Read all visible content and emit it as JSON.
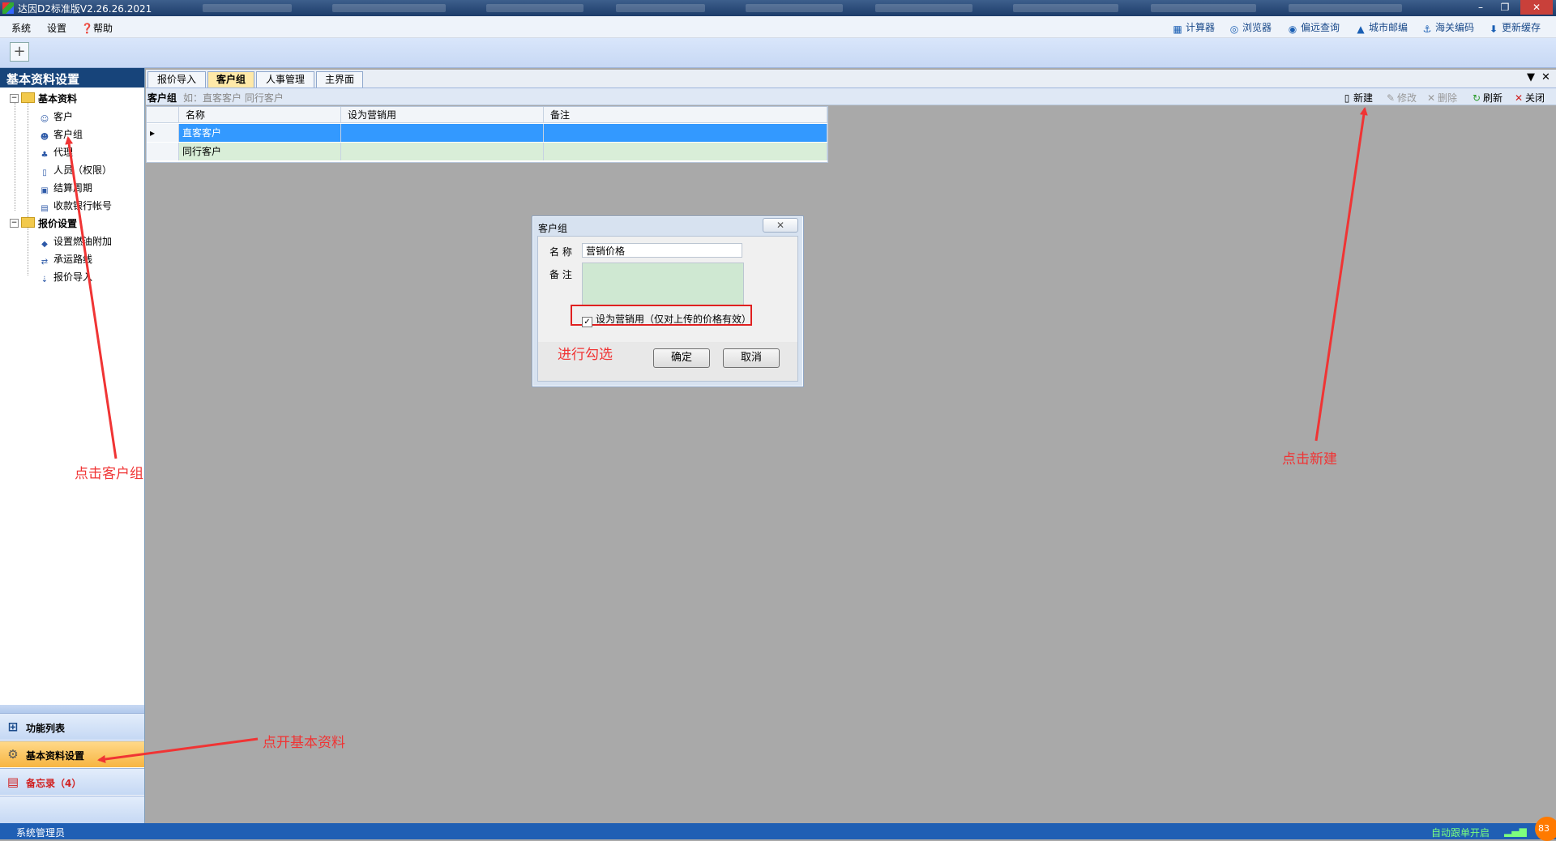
{
  "window": {
    "title": "达因D2标准版V2.26.26.2021",
    "controls": {
      "minimize": "–",
      "restore": "❐",
      "close": "✕"
    }
  },
  "menu": {
    "items": [
      "系统",
      "设置",
      "帮助"
    ]
  },
  "quick_tools": [
    {
      "label": "计算器",
      "icon": "calculator-icon"
    },
    {
      "label": "浏览器",
      "icon": "browser-icon"
    },
    {
      "label": "偏远查询",
      "icon": "location-pin-icon"
    },
    {
      "label": "城市邮编",
      "icon": "city-icon"
    },
    {
      "label": "海关编码",
      "icon": "anchor-icon"
    },
    {
      "label": "更新缓存",
      "icon": "download-icon"
    }
  ],
  "toolbar": {
    "add_symbol": "+"
  },
  "left_panel": {
    "title": "基本资料设置",
    "collapse_glyph": "«",
    "tree": {
      "group1": {
        "label": "基本资料",
        "children": [
          "客户",
          "客户组",
          "代理",
          "人员（权限）",
          "结算周期",
          "收款银行帐号"
        ]
      },
      "group2": {
        "label": "报价设置",
        "children": [
          "设置燃油附加",
          "承运路线",
          "报价导入"
        ]
      }
    },
    "nav": [
      {
        "label": "功能列表",
        "icon": "grid-icon"
      },
      {
        "label": "基本资料设置",
        "icon": "gear-icon"
      },
      {
        "label": "备忘录（4）",
        "icon": "memo-icon"
      }
    ]
  },
  "tabs": [
    {
      "label": "报价导入",
      "active": false
    },
    {
      "label": "客户组",
      "active": true
    },
    {
      "label": "人事管理",
      "active": false
    },
    {
      "label": "主界面",
      "active": false
    }
  ],
  "tab_controls": {
    "dropdown": "▼",
    "close": "✕"
  },
  "subbar": {
    "label": "客户组",
    "hint": "如：直客客户 同行客户",
    "actions": [
      {
        "label": "新建",
        "icon": "new-doc-icon",
        "enabled": true
      },
      {
        "label": "修改",
        "icon": "edit-icon",
        "enabled": false
      },
      {
        "label": "删除",
        "icon": "delete-icon",
        "enabled": false
      },
      {
        "label": "刷新",
        "icon": "refresh-icon",
        "enabled": true
      },
      {
        "label": "关闭",
        "icon": "close-icon",
        "enabled": true
      }
    ]
  },
  "grid": {
    "columns": [
      "名称",
      "设为营销用",
      "备注"
    ],
    "rows": [
      {
        "name": "直客客户",
        "marketing": "",
        "note": "",
        "selected": true
      },
      {
        "name": "同行客户",
        "marketing": "",
        "note": "",
        "selected": false
      }
    ]
  },
  "dialog": {
    "title": "客户组",
    "close_glyph": "✕",
    "name_label": "名 称",
    "name_value": "营销价格",
    "note_label": "备 注",
    "note_value": "",
    "checkbox_label": "设为营销用（仅对上传的价格有效）",
    "checkbox_checked": true,
    "checkbox_mark": "✓",
    "ok_label": "确定",
    "cancel_label": "取消"
  },
  "annotations": {
    "check": "进行勾选",
    "click_group": "点击客户组",
    "open_basic": "点开基本资料",
    "click_new": "点击新建"
  },
  "status": {
    "user": "系统管理员",
    "auto_follow": "自动跟单开启",
    "badge": "83"
  },
  "colors": {
    "title_bar": "#1d3c6a",
    "panel_header": "#17447a",
    "status_bar": "#1f5fb4",
    "selected_row": "#3399ff",
    "alt_row": "#d9eed8",
    "active_tab": "#ffe9a8",
    "active_nav": "#f7b541",
    "annotation": "#f03434"
  }
}
